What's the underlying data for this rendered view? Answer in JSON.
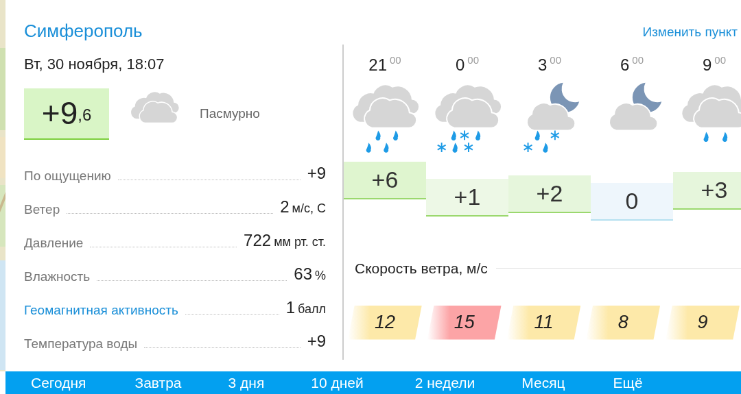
{
  "location": {
    "city": "Симферополь",
    "change_link": "Изменить пункт"
  },
  "current": {
    "datetime": "Вт, 30 ноября, 18:07",
    "temp_whole": "+9",
    "temp_fraction": ",6",
    "condition": "Пасмурно"
  },
  "details": [
    {
      "label": "По ощущению",
      "value": "+9",
      "link": false
    },
    {
      "label": "Ветер",
      "value": "2",
      "unit": "м/с, С",
      "link": false
    },
    {
      "label": "Давление",
      "value": "722",
      "unit": "мм рт. ст.",
      "link": false
    },
    {
      "label": "Влажность",
      "value": "63",
      "unit": "%",
      "link": false
    },
    {
      "label": "Геомагнитная активность",
      "value": "1",
      "unit": "балл",
      "link": true
    },
    {
      "label": "Температура воды",
      "value": "+9",
      "link": false
    }
  ],
  "forecast": [
    {
      "hour": "21",
      "minutes": "00",
      "kind": "rain",
      "temp": "+6",
      "color": "#dff5cf"
    },
    {
      "hour": "0",
      "minutes": "00",
      "kind": "rain-snow",
      "temp": "+1",
      "color": "#edf8e6"
    },
    {
      "hour": "3",
      "minutes": "00",
      "kind": "night-rain-snow",
      "temp": "+2",
      "color": "#e6f6dc"
    },
    {
      "hour": "6",
      "minutes": "00",
      "kind": "night-cloudy",
      "temp": "0",
      "color": "#eef6fc"
    },
    {
      "hour": "9",
      "minutes": "00",
      "kind": "light-rain",
      "temp": "+3",
      "color": "#e6f6dc"
    }
  ],
  "wind": {
    "title": "Скорость ветра, м/с",
    "speeds": [
      {
        "value": "12",
        "color": "#fde9a9"
      },
      {
        "value": "15",
        "color": "#fca4a6"
      },
      {
        "value": "11",
        "color": "#fde9a9"
      },
      {
        "value": "8",
        "color": "#fde9a9"
      },
      {
        "value": "9",
        "color": "#fde9a9"
      }
    ]
  },
  "nav": [
    "Сегодня",
    "Завтра",
    "3 дня",
    "10 дней",
    "2 недели",
    "Месяц",
    "Ещё"
  ]
}
